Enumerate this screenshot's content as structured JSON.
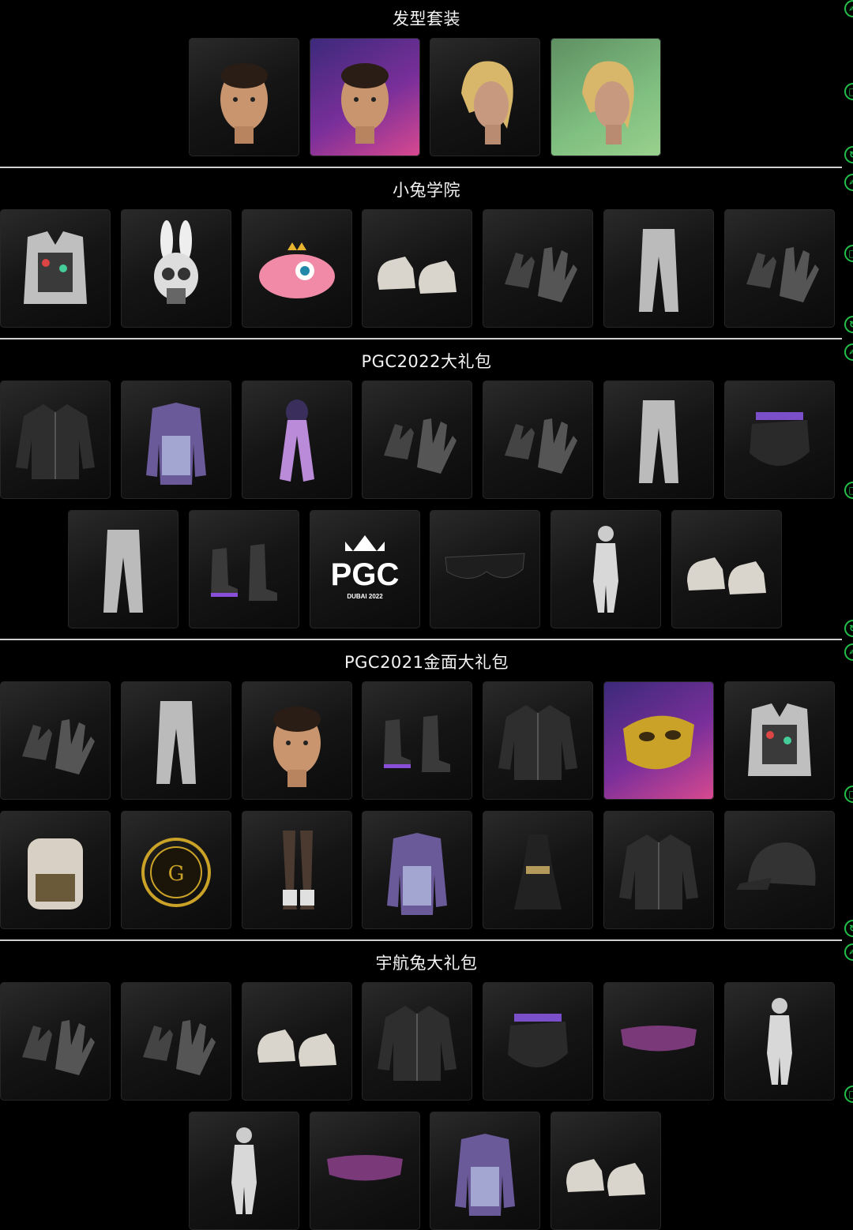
{
  "sections": [
    {
      "title": "发型套装",
      "rows": [
        [
          {
            "item": "head-icon",
            "bg": "dark"
          },
          {
            "item": "head-icon",
            "bg": "purple"
          },
          {
            "item": "hair-icon",
            "bg": "dark"
          },
          {
            "item": "hair-icon",
            "bg": "green"
          }
        ]
      ]
    },
    {
      "title": "小兔学院",
      "rows": [
        [
          {
            "item": "vest-icon",
            "bg": "dark"
          },
          {
            "item": "bunny-mask-icon",
            "bg": "dark"
          },
          {
            "item": "hat-icon",
            "bg": "dark"
          },
          {
            "item": "shoes-icon",
            "bg": "dark"
          },
          {
            "item": "gloves-icon",
            "bg": "dark"
          },
          {
            "item": "pants-icon",
            "bg": "dark"
          },
          {
            "item": "gloves-icon",
            "bg": "dark"
          }
        ]
      ]
    },
    {
      "title": "PGC2022大礼包",
      "rows": [
        [
          {
            "item": "jacket-icon",
            "bg": "dark"
          },
          {
            "item": "coat-icon",
            "bg": "dark"
          },
          {
            "item": "scarf-icon",
            "bg": "dark"
          },
          {
            "item": "gloves-icon",
            "bg": "dark"
          },
          {
            "item": "gloves-icon",
            "bg": "dark"
          },
          {
            "item": "pants-icon",
            "bg": "dark"
          },
          {
            "item": "mask-icon",
            "bg": "dark"
          }
        ],
        [
          {
            "item": "pants-icon",
            "bg": "dark"
          },
          {
            "item": "boots-icon",
            "bg": "dark"
          },
          {
            "item": "pgc-logo",
            "bg": "dark",
            "logo_text": "PGC",
            "logo_sub": "DUBAI 2022"
          },
          {
            "item": "glasses-icon",
            "bg": "dark"
          },
          {
            "item": "bodysuit-icon",
            "bg": "dark"
          },
          {
            "item": "shoes-icon",
            "bg": "dark"
          }
        ]
      ]
    },
    {
      "title": "PGC2021金面大礼包",
      "rows": [
        [
          {
            "item": "gloves-icon",
            "bg": "dark"
          },
          {
            "item": "pants-icon",
            "bg": "dark"
          },
          {
            "item": "head-icon",
            "bg": "dark"
          },
          {
            "item": "boots-icon",
            "bg": "dark"
          },
          {
            "item": "jacket-icon",
            "bg": "dark"
          },
          {
            "item": "gold-mask-icon",
            "bg": "purple"
          },
          {
            "item": "vest-icon",
            "bg": "dark"
          }
        ],
        [
          {
            "item": "backpack-icon",
            "bg": "dark"
          },
          {
            "item": "emblem-icon",
            "bg": "dark"
          },
          {
            "item": "legs-icon",
            "bg": "dark"
          },
          {
            "item": "coat-icon",
            "bg": "dark"
          },
          {
            "item": "dress-icon",
            "bg": "dark"
          },
          {
            "item": "jacket-icon",
            "bg": "dark"
          },
          {
            "item": "cap-icon",
            "bg": "dark"
          }
        ]
      ]
    },
    {
      "title": "宇航兔大礼包",
      "rows": [
        [
          {
            "item": "gloves-icon",
            "bg": "dark"
          },
          {
            "item": "gloves-icon",
            "bg": "dark"
          },
          {
            "item": "shoes-icon",
            "bg": "dark"
          },
          {
            "item": "jacket-icon",
            "bg": "dark"
          },
          {
            "item": "mask-icon",
            "bg": "dark"
          },
          {
            "item": "visor-icon",
            "bg": "dark"
          },
          {
            "item": "bodysuit-icon",
            "bg": "dark"
          }
        ],
        [
          {
            "item": "bodysuit-icon",
            "bg": "dark"
          },
          {
            "item": "visor-icon",
            "bg": "dark"
          },
          {
            "item": "coat-icon",
            "bg": "dark"
          },
          {
            "item": "shoes-icon",
            "bg": "dark"
          }
        ]
      ]
    }
  ],
  "side_icons": [
    "ai-icon",
    "copy-icon",
    "refresh-icon"
  ]
}
